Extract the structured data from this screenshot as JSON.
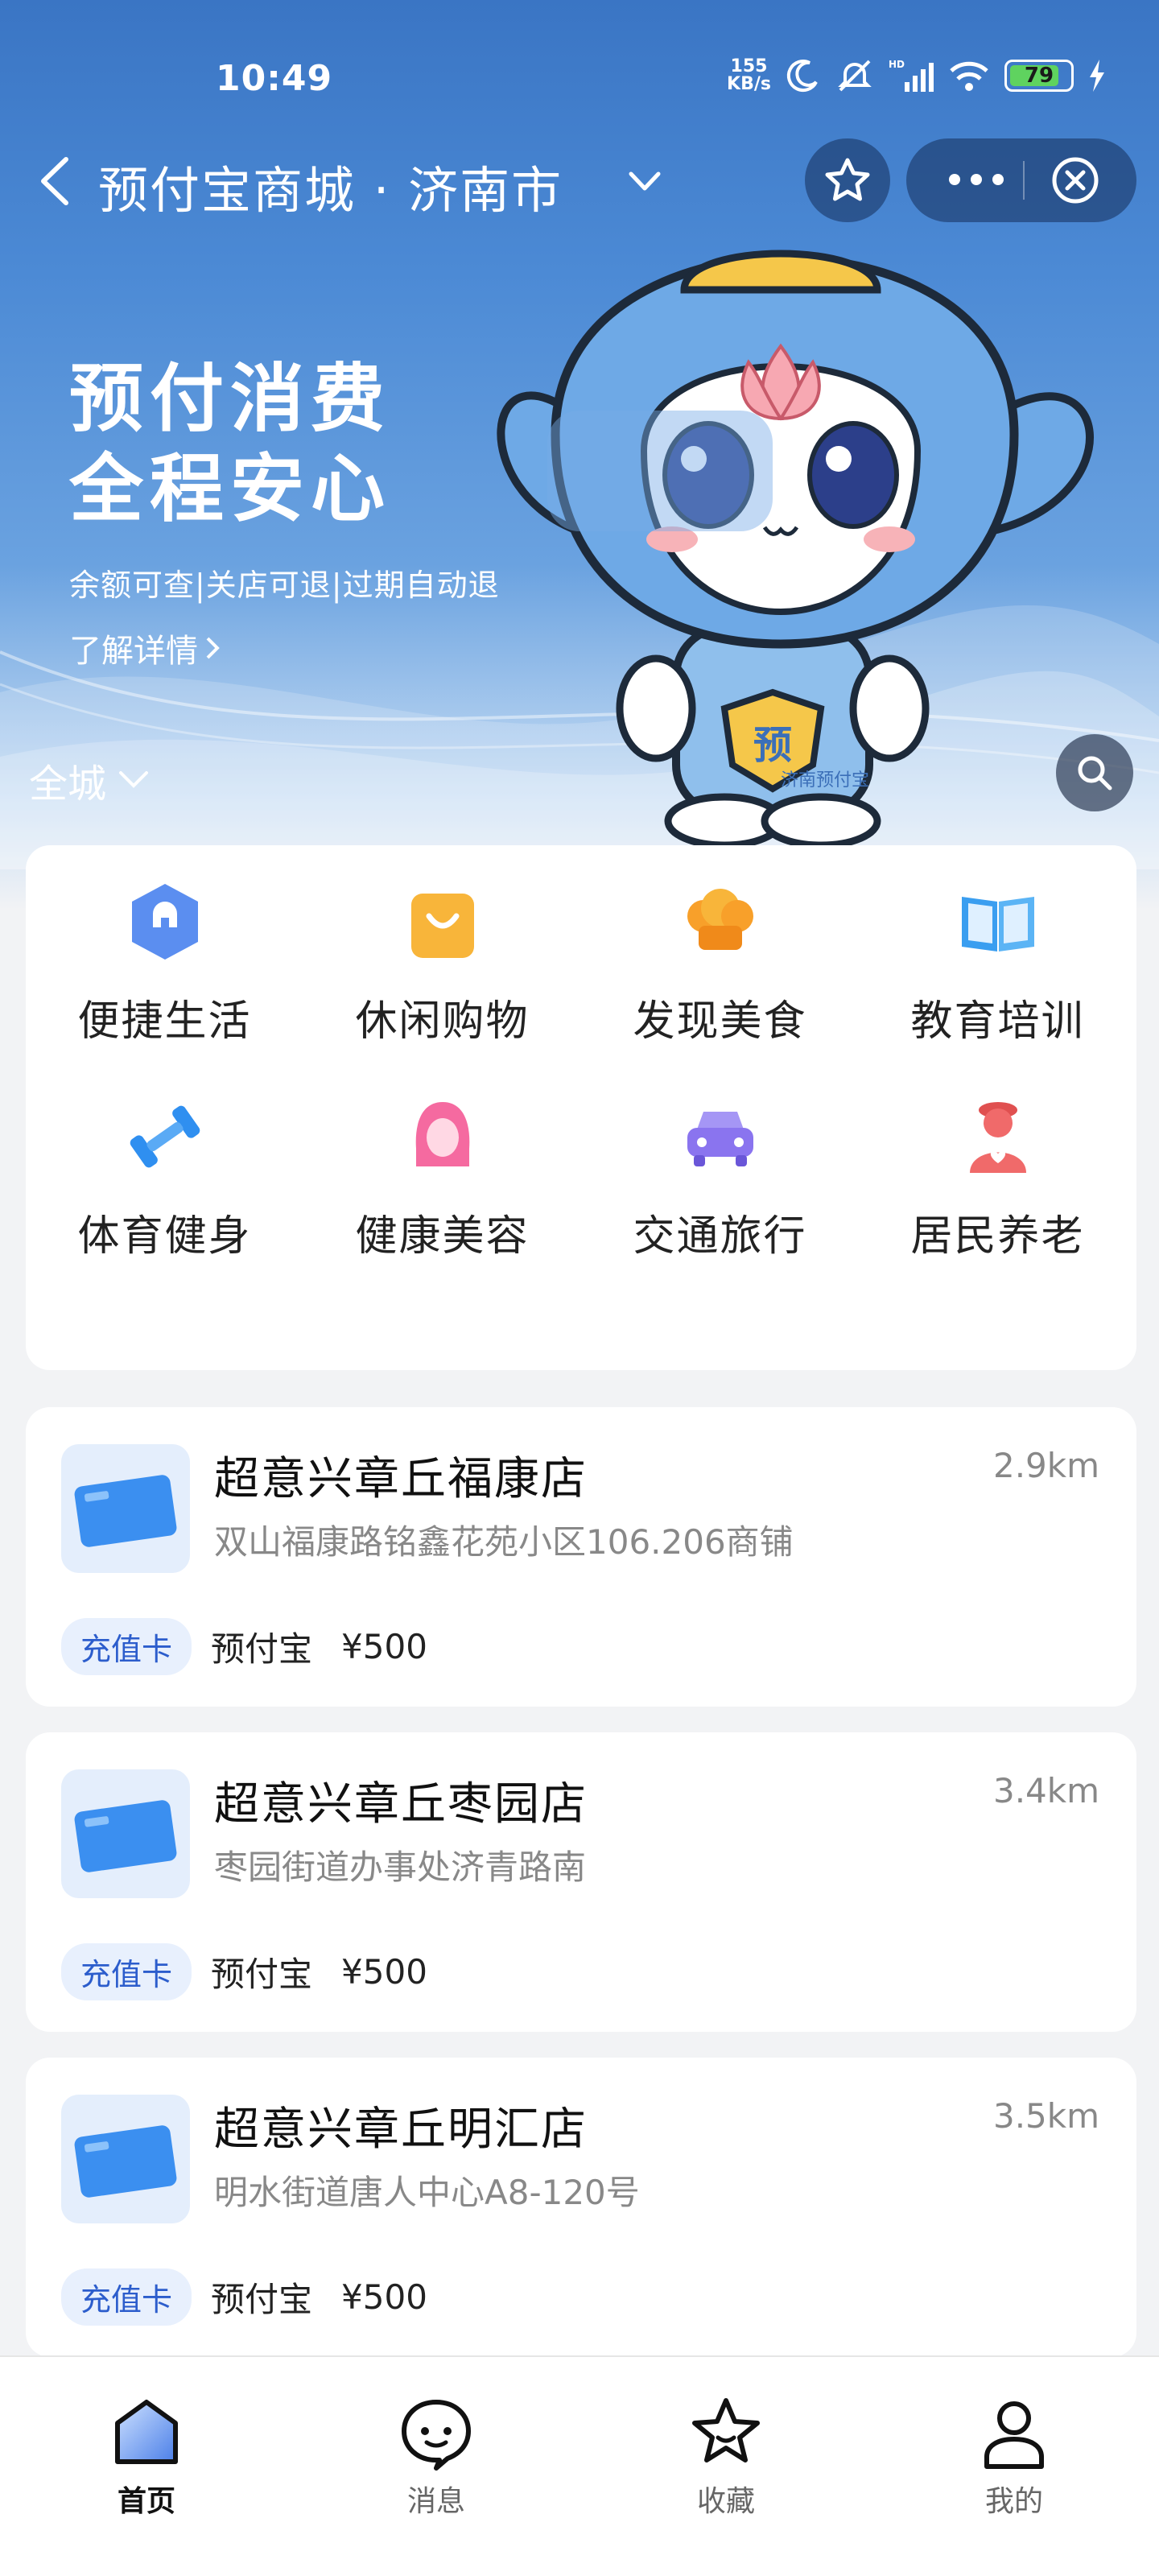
{
  "status_bar": {
    "time": "10:49",
    "net_speed_value": "155",
    "net_speed_unit": "KB/s",
    "battery": "79"
  },
  "nav": {
    "title": "预付宝商城 · 济南市"
  },
  "banner": {
    "slogan_line1": "预付消费",
    "slogan_line2": "全程安心",
    "subtitle": "余额可查|关店可退|过期自动退",
    "link": "了解详情",
    "mascot_badge_char": "预",
    "mascot_belt_text": "济南预付宝"
  },
  "city_select": {
    "label": "全城"
  },
  "categories": [
    {
      "label": "便捷生活",
      "icon": "wrench-hexagon-icon",
      "color": "#5b8ef0"
    },
    {
      "label": "休闲购物",
      "icon": "shopping-bag-icon",
      "color": "#f8b53a"
    },
    {
      "label": "发现美食",
      "icon": "chef-hat-icon",
      "color": "#f8a02a"
    },
    {
      "label": "教育培训",
      "icon": "book-icon",
      "color": "#3a9ef0"
    },
    {
      "label": "体育健身",
      "icon": "dumbbell-icon",
      "color": "#2f8ff0"
    },
    {
      "label": "健康美容",
      "icon": "beauty-woman-icon",
      "color": "#f56aa0"
    },
    {
      "label": "交通旅行",
      "icon": "car-icon",
      "color": "#8a74ef"
    },
    {
      "label": "居民养老",
      "icon": "elder-heart-icon",
      "color": "#f06a6a"
    }
  ],
  "stores": [
    {
      "name": "超意兴章丘福康店",
      "address": "双山福康路铭鑫花苑小区106.206商铺",
      "distance": "2.9km",
      "tag": "充值卡",
      "issuer": "预付宝",
      "price": "¥500"
    },
    {
      "name": "超意兴章丘枣园店",
      "address": "枣园街道办事处济青路南",
      "distance": "3.4km",
      "tag": "充值卡",
      "issuer": "预付宝",
      "price": "¥500"
    },
    {
      "name": "超意兴章丘明汇店",
      "address": "明水街道唐人中心A8-120号",
      "distance": "3.5km",
      "tag": "充值卡",
      "issuer": "预付宝",
      "price": "¥500"
    }
  ],
  "tabbar": [
    {
      "label": "首页",
      "icon": "home-icon",
      "active": true
    },
    {
      "label": "消息",
      "icon": "message-icon",
      "active": false
    },
    {
      "label": "收藏",
      "icon": "star-icon",
      "active": false
    },
    {
      "label": "我的",
      "icon": "user-icon",
      "active": false
    }
  ],
  "colors": {
    "primary_blue": "#3a75c4",
    "tag_blue": "#2c5dcc",
    "tag_bg": "#e8f0fd"
  }
}
